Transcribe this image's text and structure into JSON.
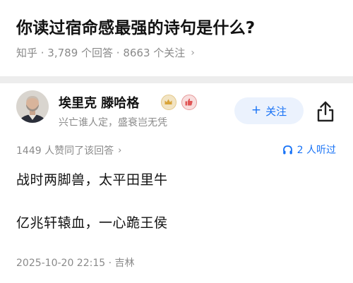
{
  "question": {
    "title": "你读过宿命感最强的诗句是什么?",
    "meta": "知乎 · 3,789 个回答 · 8663 个关注",
    "meta_chevron": "›"
  },
  "author": {
    "name": "埃里克 滕哈格",
    "bio": "兴亡谁人定，盛衰岂无凭",
    "avatar_icon": "person-avatar",
    "badges": [
      "crown-badge-icon",
      "thumb-up-badge-icon"
    ]
  },
  "actions": {
    "follow_plus": "+",
    "follow_label": "关注",
    "share_icon": "share-icon"
  },
  "stats": {
    "upvote_text": "1449 人赞同了该回答",
    "upvote_chevron": "›",
    "listen_text": "2 人听过"
  },
  "content": {
    "lines": [
      "战时两脚兽，太平田里牛",
      "亿兆轩辕血，一心跪王侯"
    ]
  },
  "footer": {
    "post_meta": "2025-10-20 22:15 · 吉林"
  },
  "colors": {
    "accent": "#1772f6",
    "follow_bg": "#ebf2fd",
    "page_bg": "#ededed"
  }
}
